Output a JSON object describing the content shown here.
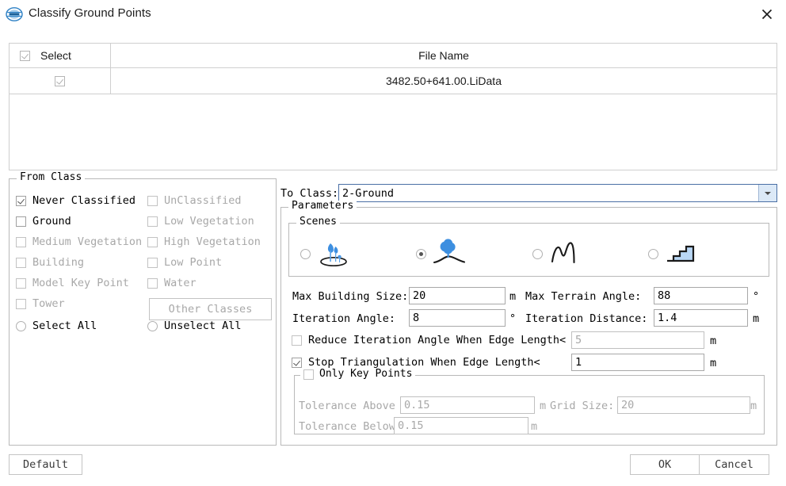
{
  "window": {
    "title": "Classify Ground Points",
    "logo_icon": "lidar360-logo-icon",
    "close_icon": "close-icon"
  },
  "file_table": {
    "columns": [
      "Select",
      "File Name"
    ],
    "header_checkbox_checked": true,
    "rows": [
      {
        "selected": true,
        "file_name": "3482.50+641.00.LiData"
      }
    ]
  },
  "from_class": {
    "title": "From Class",
    "items": [
      {
        "label": "Never Classified",
        "checked": true,
        "enabled": true
      },
      {
        "label": "UnClassified",
        "checked": false,
        "enabled": false
      },
      {
        "label": "Ground",
        "checked": false,
        "enabled": true
      },
      {
        "label": "Low Vegetation",
        "checked": false,
        "enabled": false
      },
      {
        "label": "Medium Vegetation",
        "checked": false,
        "enabled": false
      },
      {
        "label": "High Vegetation",
        "checked": false,
        "enabled": false
      },
      {
        "label": "Building",
        "checked": false,
        "enabled": false
      },
      {
        "label": "Low Point",
        "checked": false,
        "enabled": false
      },
      {
        "label": "Model Key Point",
        "checked": false,
        "enabled": false
      },
      {
        "label": "Water",
        "checked": false,
        "enabled": false
      },
      {
        "label": "Tower",
        "checked": false,
        "enabled": false
      }
    ],
    "other_classes_button": "Other Classes",
    "select_all": "Select All",
    "unselect_all": "Unselect All",
    "select_all_selected": false,
    "unselect_all_selected": false
  },
  "to_class": {
    "label": "To Class:",
    "value": "2-Ground",
    "dropdown_icon": "chevron-down-icon"
  },
  "parameters": {
    "title": "Parameters",
    "scenes": {
      "title": "Scenes",
      "options": [
        {
          "icon": "flat-sparse-trees-icon",
          "selected": false
        },
        {
          "icon": "tree-on-hill-icon",
          "selected": true
        },
        {
          "icon": "mountain-curve-icon",
          "selected": false
        },
        {
          "icon": "stairs-terrain-icon",
          "selected": false
        }
      ]
    },
    "fields": {
      "max_building_size": {
        "label": "Max Building Size:",
        "value": "20",
        "unit": "m",
        "enabled": true
      },
      "max_terrain_angle": {
        "label": "Max Terrain Angle:",
        "value": "88",
        "unit": "°",
        "enabled": true
      },
      "iteration_angle": {
        "label": "Iteration Angle:",
        "value": "8",
        "unit": "°",
        "enabled": true
      },
      "iteration_distance": {
        "label": "Iteration Distance:",
        "value": "1.4",
        "unit": "m",
        "enabled": true
      }
    },
    "reduce_iteration": {
      "label": "Reduce Iteration Angle When Edge Length<",
      "checked": false,
      "value": "5",
      "unit": "m",
      "enabled": false
    },
    "stop_triangulation": {
      "label": "Stop Triangulation When Edge Length<",
      "checked": true,
      "value": "1",
      "unit": "m",
      "enabled": true
    },
    "only_key_points": {
      "title": "Only Key Points",
      "checked": false,
      "tolerance_above": {
        "label": "Tolerance Above",
        "value": "0.15",
        "unit": "m"
      },
      "tolerance_below": {
        "label": "Tolerance Below",
        "value": "0.15",
        "unit": "m"
      },
      "grid_size": {
        "label": "Grid Size:",
        "value": "20",
        "unit": "m"
      }
    }
  },
  "buttons": {
    "default": "Default",
    "ok": "OK",
    "cancel": "Cancel"
  },
  "colors": {
    "accent_blue": "#4a90e2",
    "combo_border": "#4a6fa5",
    "disabled_text": "#a8a8a8"
  }
}
